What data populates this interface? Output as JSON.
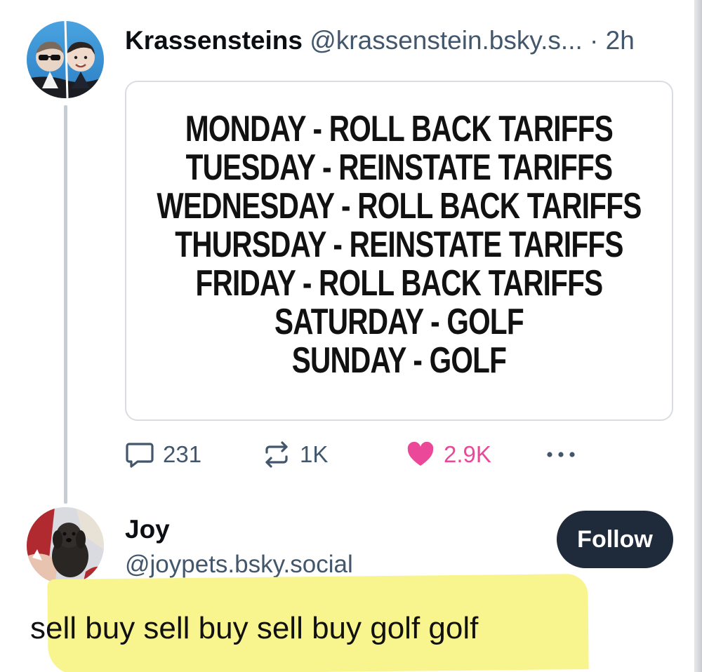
{
  "post": {
    "display_name": "Krassensteins",
    "handle": "@krassenstein.bsky.s...",
    "dot": "·",
    "time": "2h",
    "avatar_icon": "two-people-avatar",
    "embed": {
      "lines": [
        "MONDAY - ROLL BACK TARIFFS",
        "TUESDAY - REINSTATE TARIFFS",
        "WEDNESDAY - ROLL BACK TARIFFS",
        "THURSDAY - REINSTATE TARIFFS",
        "FRIDAY - ROLL BACK TARIFFS",
        "SATURDAY - GOLF",
        "SUNDAY - GOLF"
      ]
    },
    "actions": {
      "reply_count": "231",
      "repost_count": "1K",
      "like_count": "2.9K",
      "like_color": "#ec4899"
    }
  },
  "reply": {
    "display_name": "Joy",
    "handle": "@joypets.bsky.social",
    "avatar_icon": "dog-avatar",
    "follow_label": "Follow",
    "text": "sell buy sell buy sell buy golf golf",
    "highlight_color": "#f8f58e"
  }
}
